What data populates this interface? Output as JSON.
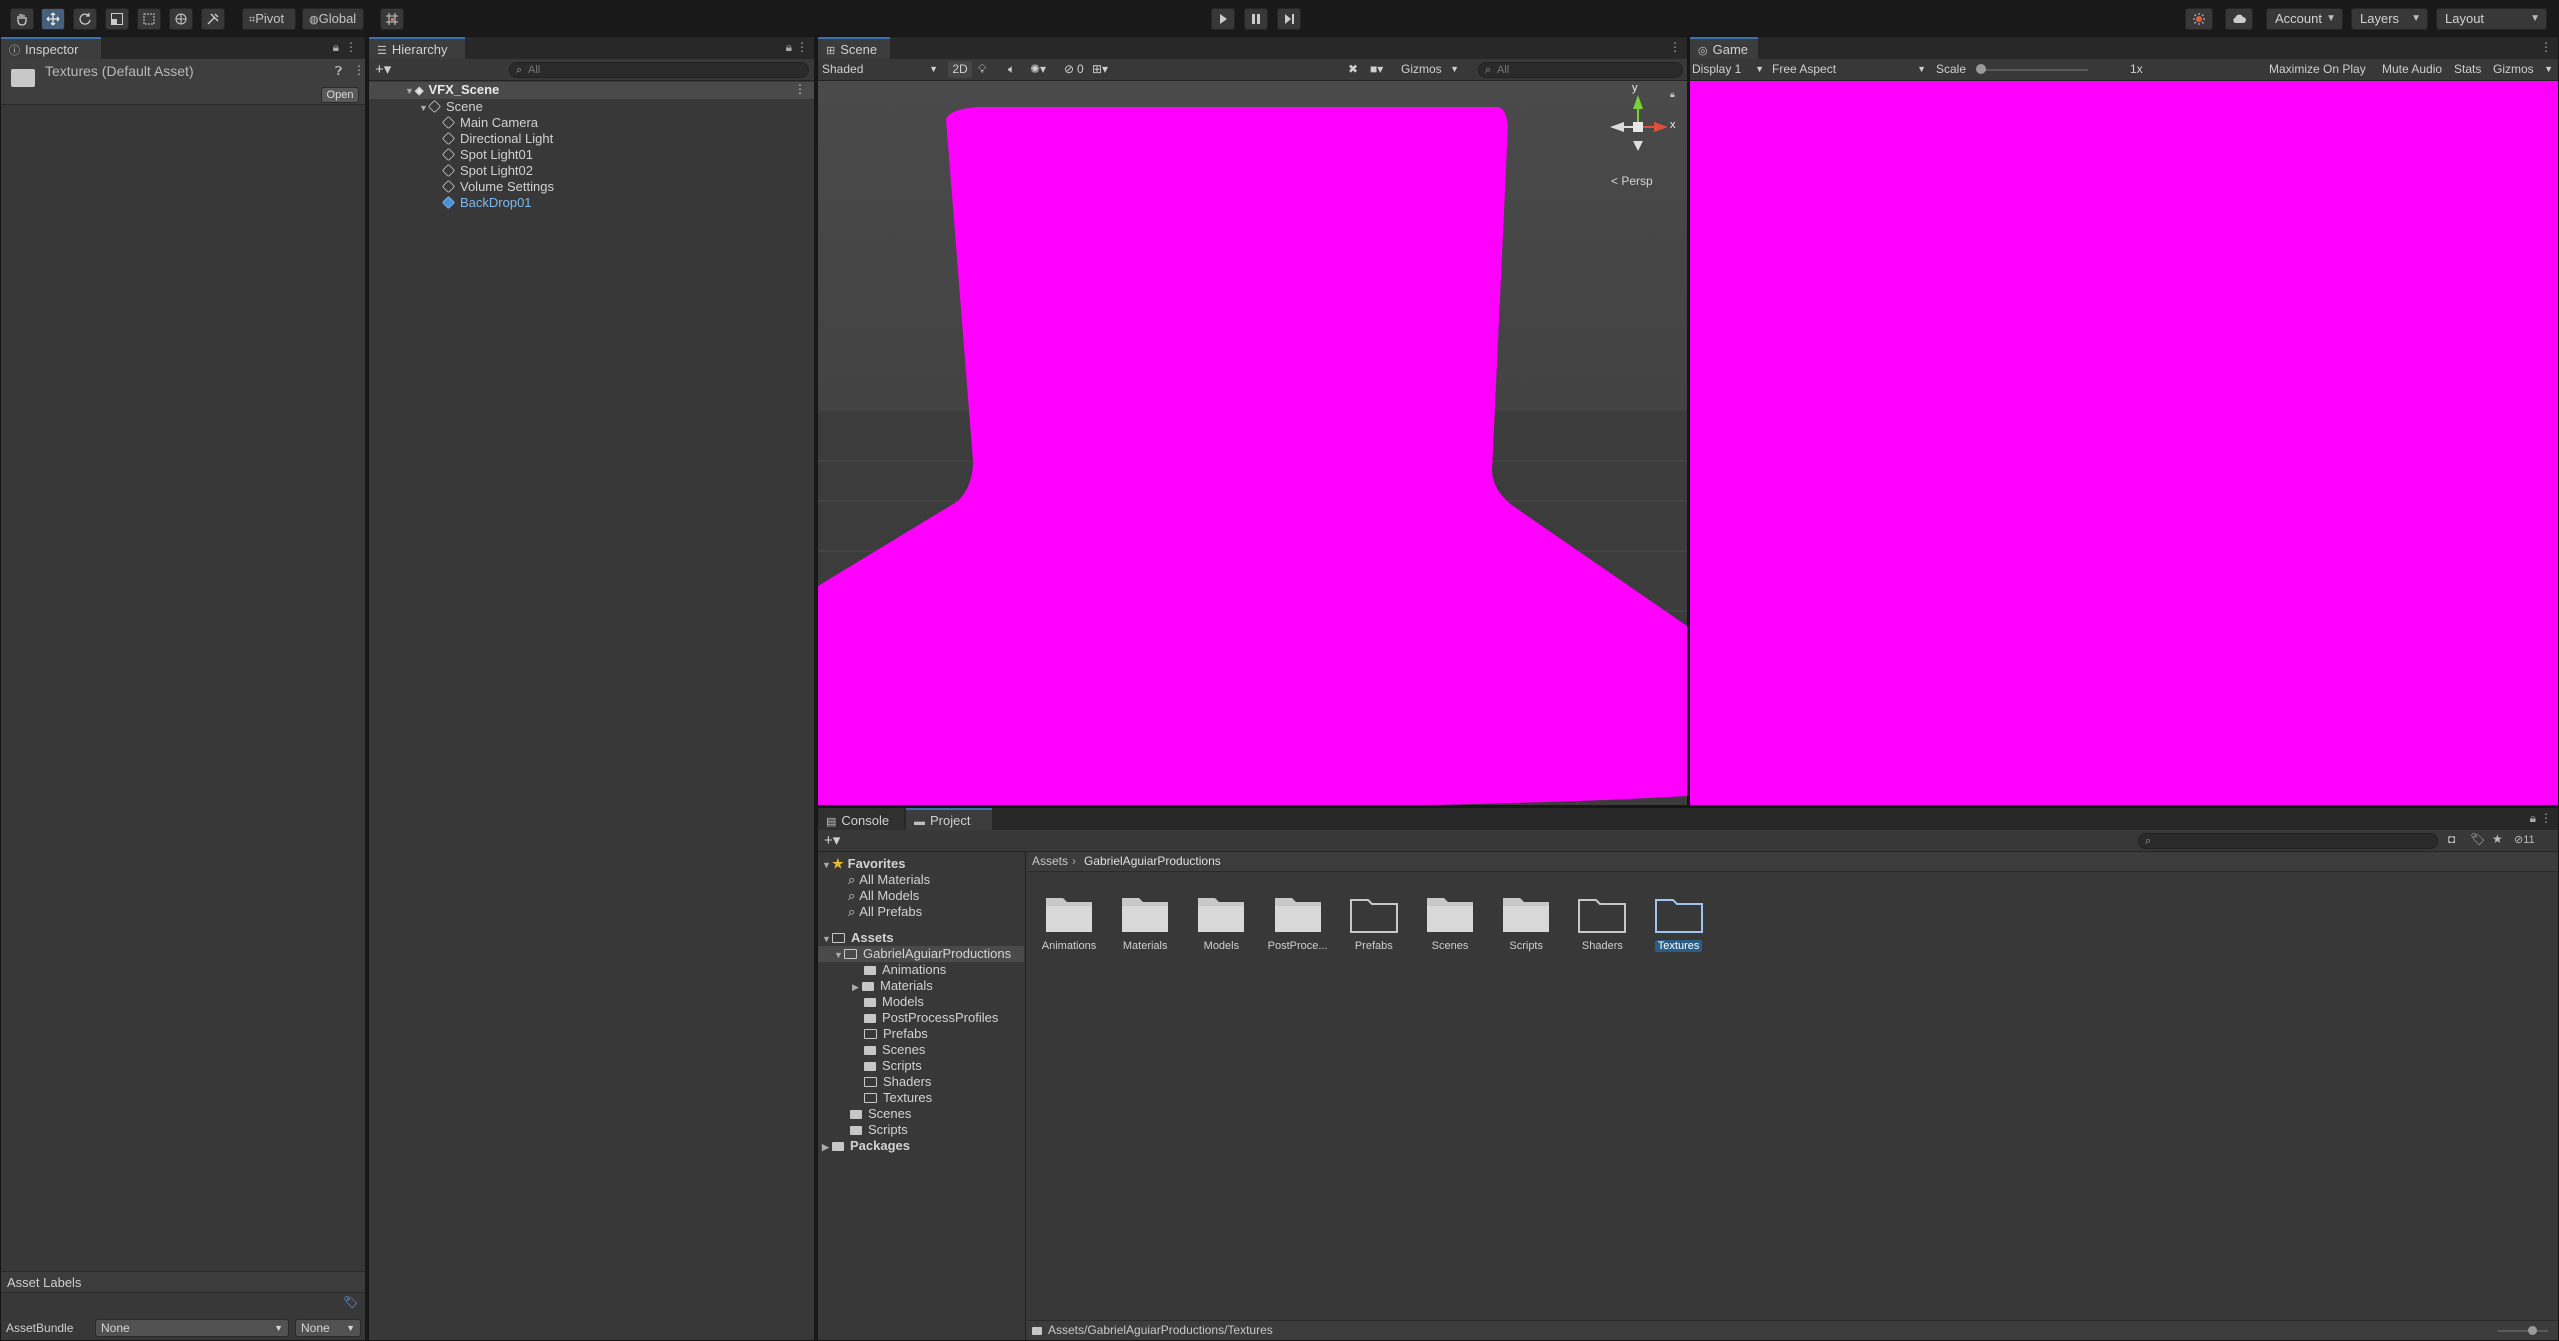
{
  "toolbar": {
    "pivot_label": "Pivot",
    "global_label": "Global",
    "account_label": "Account",
    "layers_label": "Layers",
    "layout_label": "Layout"
  },
  "inspector": {
    "tab_label": "Inspector",
    "asset_title": "Textures (Default Asset)",
    "open_button": "Open",
    "asset_labels_title": "Asset Labels",
    "asset_bundle_label": "AssetBundle",
    "asset_bundle_value": "None",
    "asset_variant_value": "None"
  },
  "hierarchy": {
    "tab_label": "Hierarchy",
    "search_placeholder": "All",
    "root": "VFX_Scene",
    "items": [
      "Scene",
      "Main Camera",
      "Directional Light",
      "Spot Light01",
      "Spot Light02",
      "Volume Settings",
      "BackDrop01"
    ]
  },
  "scene": {
    "tab_label": "Scene",
    "shading_mode": "Shaded",
    "mode_2d": "2D",
    "hidden_count": "0",
    "gizmos_label": "Gizmos",
    "search_placeholder": "All",
    "gizmo_y": "y",
    "gizmo_x": "x",
    "persp_label": "< Persp",
    "object_color": "#ff00ff"
  },
  "game": {
    "tab_label": "Game",
    "display": "Display 1",
    "aspect": "Free Aspect",
    "scale_label": "Scale",
    "scale_value": "1x",
    "maximize_label": "Maximize On Play",
    "mute_label": "Mute Audio",
    "stats_label": "Stats",
    "gizmos_label": "Gizmos",
    "view_color": "#ff00ff"
  },
  "bottom": {
    "console_tab": "Console",
    "project_tab": "Project",
    "hidden_count": "11"
  },
  "project": {
    "favorites_label": "Favorites",
    "favorites": [
      "All Materials",
      "All Models",
      "All Prefabs"
    ],
    "assets_label": "Assets",
    "main_folder": "GabrielAguiarProductions",
    "subfolders": [
      "Animations",
      "Materials",
      "Models",
      "PostProcessProfiles",
      "Prefabs",
      "Scenes",
      "Scripts",
      "Shaders",
      "Textures"
    ],
    "asset_root_folders": [
      "Scenes",
      "Scripts"
    ],
    "packages_label": "Packages",
    "breadcrumb_root": "Assets",
    "breadcrumb_current": "GabrielAguiarProductions",
    "grid_items": [
      "Animations",
      "Materials",
      "Models",
      "PostProce...",
      "Prefabs",
      "Scenes",
      "Scripts",
      "Shaders",
      "Textures"
    ],
    "path": "Assets/GabrielAguiarProductions/Textures"
  }
}
